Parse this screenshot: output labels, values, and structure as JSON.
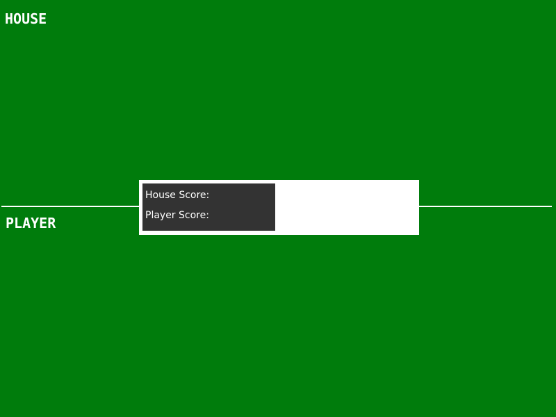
{
  "zones": {
    "house_label": "HOUSE",
    "player_label": "PLAYER"
  },
  "scoreboard": {
    "house_score_label": "House Score:",
    "house_score_value": "",
    "player_score_label": "Player Score:",
    "player_score_value": ""
  },
  "colors": {
    "table_felt": "#007c0c",
    "panel_background": "#ffffff",
    "score_box_background": "#333333",
    "text": "#ffffff"
  }
}
